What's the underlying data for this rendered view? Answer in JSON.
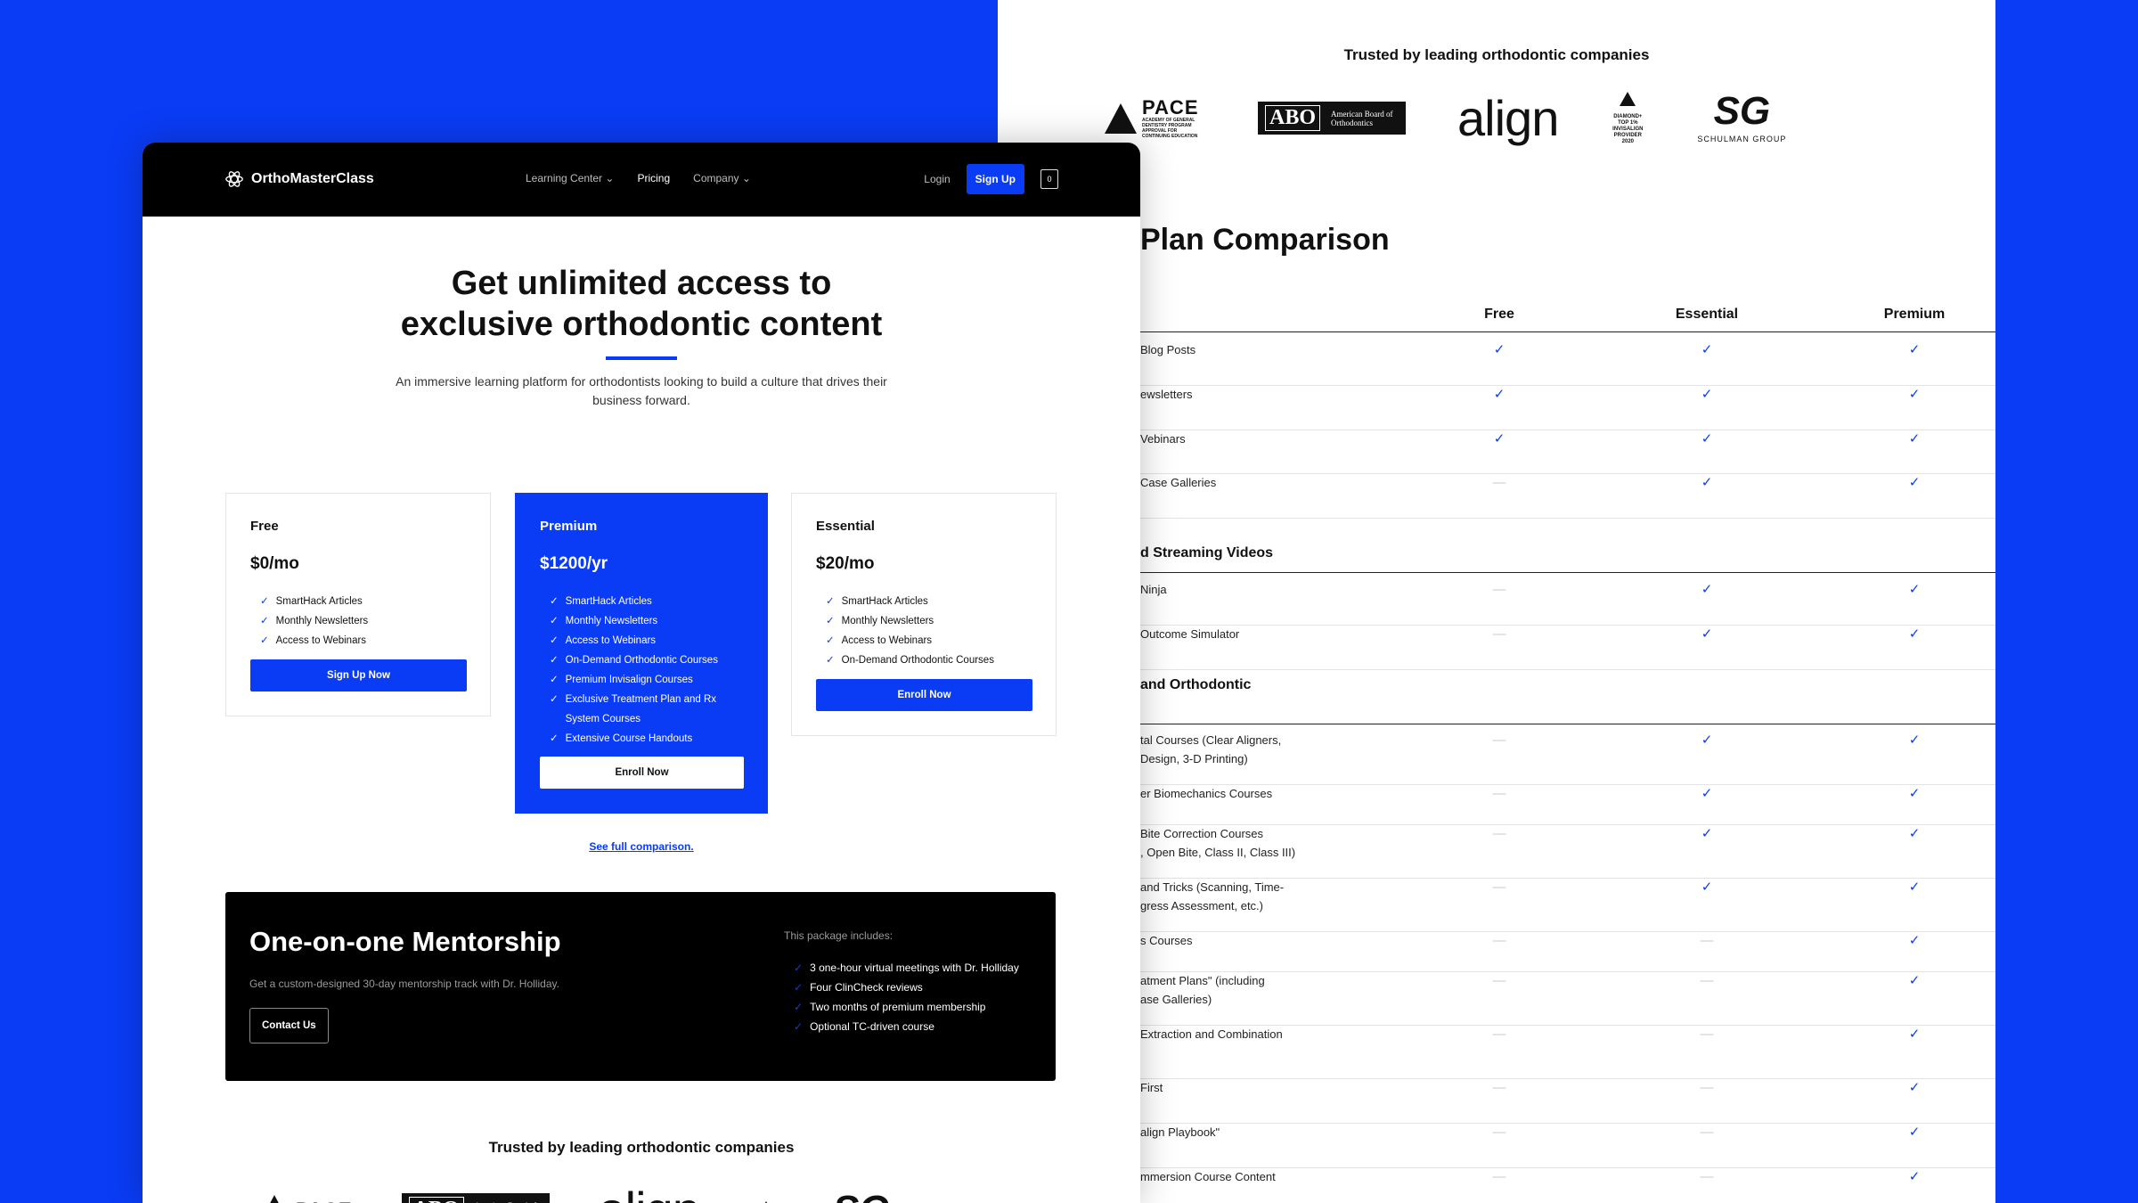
{
  "back": {
    "trusted_title": "Trusted by leading orthodontic companies",
    "logos": {
      "pace": {
        "name": "PACE",
        "sub": "ACADEMY OF GENERAL DENTISTRY PROGRAM APPROVAL FOR CONTINUING EDUCATION"
      },
      "abo": {
        "name": "ABO",
        "sub": "American Board of Orthodontics"
      },
      "align": {
        "name": "align"
      },
      "diamond": {
        "sub": "DIAMOND+ TOP 1% INVISALIGN PROVIDER 2020"
      },
      "schulman": {
        "name": "SG",
        "sub": "SCHULMAN GROUP"
      }
    },
    "plan_title": "Plan Comparison",
    "columns": [
      "Free",
      "Essential",
      "Premium"
    ],
    "groups": [
      {
        "title": "",
        "rows": [
          {
            "label": "Blog Posts",
            "values": [
              "check",
              "check",
              "check"
            ]
          },
          {
            "label": "ewsletters",
            "values": [
              "check",
              "check",
              "check"
            ]
          },
          {
            "label": "Vebinars",
            "values": [
              "check",
              "check",
              "check"
            ]
          },
          {
            "label": "Case Galleries",
            "values": [
              "dash",
              "check",
              "check"
            ]
          }
        ]
      },
      {
        "title": "d Streaming Videos",
        "rows": [
          {
            "label": "Ninja",
            "values": [
              "dash",
              "check",
              "check"
            ]
          },
          {
            "label": "Outcome Simulator",
            "values": [
              "dash",
              "check",
              "check"
            ]
          }
        ]
      },
      {
        "title": "and Orthodontic",
        "rows": [
          {
            "label": "tal Courses (Clear Aligners,",
            "label2": " Design, 3-D Printing)",
            "values": [
              "dash",
              "check",
              "check"
            ]
          },
          {
            "label": "er Biomechanics Courses",
            "values": [
              "dash",
              "check",
              "check"
            ]
          },
          {
            "label": "Bite Correction Courses",
            "label2": ", Open Bite, Class II, Class III)",
            "values": [
              "dash",
              "check",
              "check"
            ]
          },
          {
            "label": " and Tricks (Scanning, Time-",
            "label2": "gress Assessment, etc.)",
            "values": [
              "dash",
              "check",
              "check"
            ]
          },
          {
            "label": "s Courses",
            "values": [
              "dash",
              "dash",
              "check"
            ]
          },
          {
            "label": "atment Plans\" (including",
            "label2": "ase Galleries)",
            "values": [
              "dash",
              "dash",
              "check"
            ]
          },
          {
            "label": "Extraction and Combination",
            "values": [
              "dash",
              "dash",
              "check"
            ]
          },
          {
            "label": "First",
            "values": [
              "dash",
              "dash",
              "check"
            ]
          },
          {
            "label": "align Playbook\"",
            "values": [
              "dash",
              "dash",
              "check"
            ]
          },
          {
            "label": "mmersion Course Content",
            "values": [
              "dash",
              "dash",
              "check"
            ]
          }
        ]
      }
    ]
  },
  "front": {
    "nav": {
      "brand": "OrthoMasterClass",
      "links": [
        "Learning Center",
        "Pricing",
        "Company"
      ],
      "login": "Login",
      "signup": "Sign Up",
      "cart_count": "0"
    },
    "hero": {
      "title_line1": "Get unlimited access to",
      "title_line2": "exclusive orthodontic content",
      "subtitle": "An immersive learning platform for orthodontists looking to build a culture that drives their business forward."
    },
    "plans": [
      {
        "name": "Free",
        "price": "$0/mo",
        "features": [
          "SmartHack Articles",
          "Monthly Newsletters",
          "Access to Webinars"
        ],
        "cta": "Sign Up Now"
      },
      {
        "name": "Premium",
        "price": "$1200/yr",
        "features": [
          "SmartHack Articles",
          "Monthly Newsletters",
          "Access to Webinars",
          "On-Demand Orthodontic Courses",
          "Premium Invisalign Courses",
          "Exclusive Treatment Plan and Rx System Courses",
          "Extensive Course Handouts"
        ],
        "cta": "Enroll Now"
      },
      {
        "name": "Essential",
        "price": "$20/mo",
        "features": [
          "SmartHack Articles",
          "Monthly Newsletters",
          "Access to Webinars",
          "On-Demand Orthodontic Courses"
        ],
        "cta": "Enroll Now"
      }
    ],
    "full_comparison": "See full comparison.",
    "mentorship": {
      "title": "One-on-one Mentorship",
      "subtitle": "Get a custom-designed 30-day mentorship track with Dr. Holliday.",
      "cta": "Contact Us",
      "includes_label": "This package includes:",
      "features": [
        "3 one-hour virtual meetings with Dr. Holliday",
        "Four ClinCheck reviews",
        "Two months of premium membership",
        "Optional TC-driven course"
      ]
    },
    "trusted_title": "Trusted by leading orthodontic companies"
  },
  "colors": {
    "accent": "#0a3cf5",
    "background": "#0a3cf5",
    "nav": "#000000"
  }
}
